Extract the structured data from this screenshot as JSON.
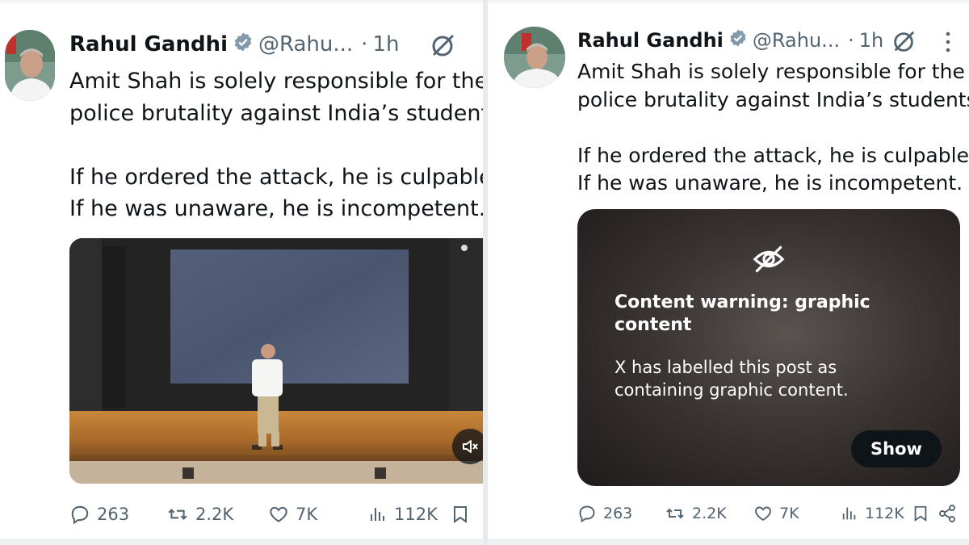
{
  "tweet": {
    "author_name": "Rahul Gandhi",
    "handle": "@Rahu...",
    "separator": "·",
    "time": "1h",
    "text_line_1": "Amit Shah is solely responsible for the",
    "text_line_2_left": "police brutality against India’s student",
    "text_line_2_right": "police brutality against India’s students.",
    "text_line_3_left": "If he ordered the attack, he is culpable",
    "text_line_3_right": "If he ordered the attack, he is culpable.",
    "text_line_4": "If he was unaware, he is incompetent."
  },
  "stats": {
    "replies": "263",
    "reposts": "2.2K",
    "likes": "7K",
    "views": "112K"
  },
  "content_warning": {
    "title": "Content warning: graphic content",
    "body": "X has labelled this post as containing graphic content.",
    "show_label": "Show"
  },
  "icons": {
    "verified": "verified-badge-icon",
    "hide": "eye-slash-icon",
    "more": "more-vertical-icon",
    "reply": "reply-icon",
    "repost": "repost-icon",
    "like": "heart-icon",
    "views": "views-chart-icon",
    "bookmark": "bookmark-icon",
    "share": "share-icon",
    "mute": "speaker-muted-icon"
  },
  "colors": {
    "text": "#0f1419",
    "secondary": "#536471",
    "verified_badge": "#829aab",
    "show_button": "#0f1419"
  }
}
